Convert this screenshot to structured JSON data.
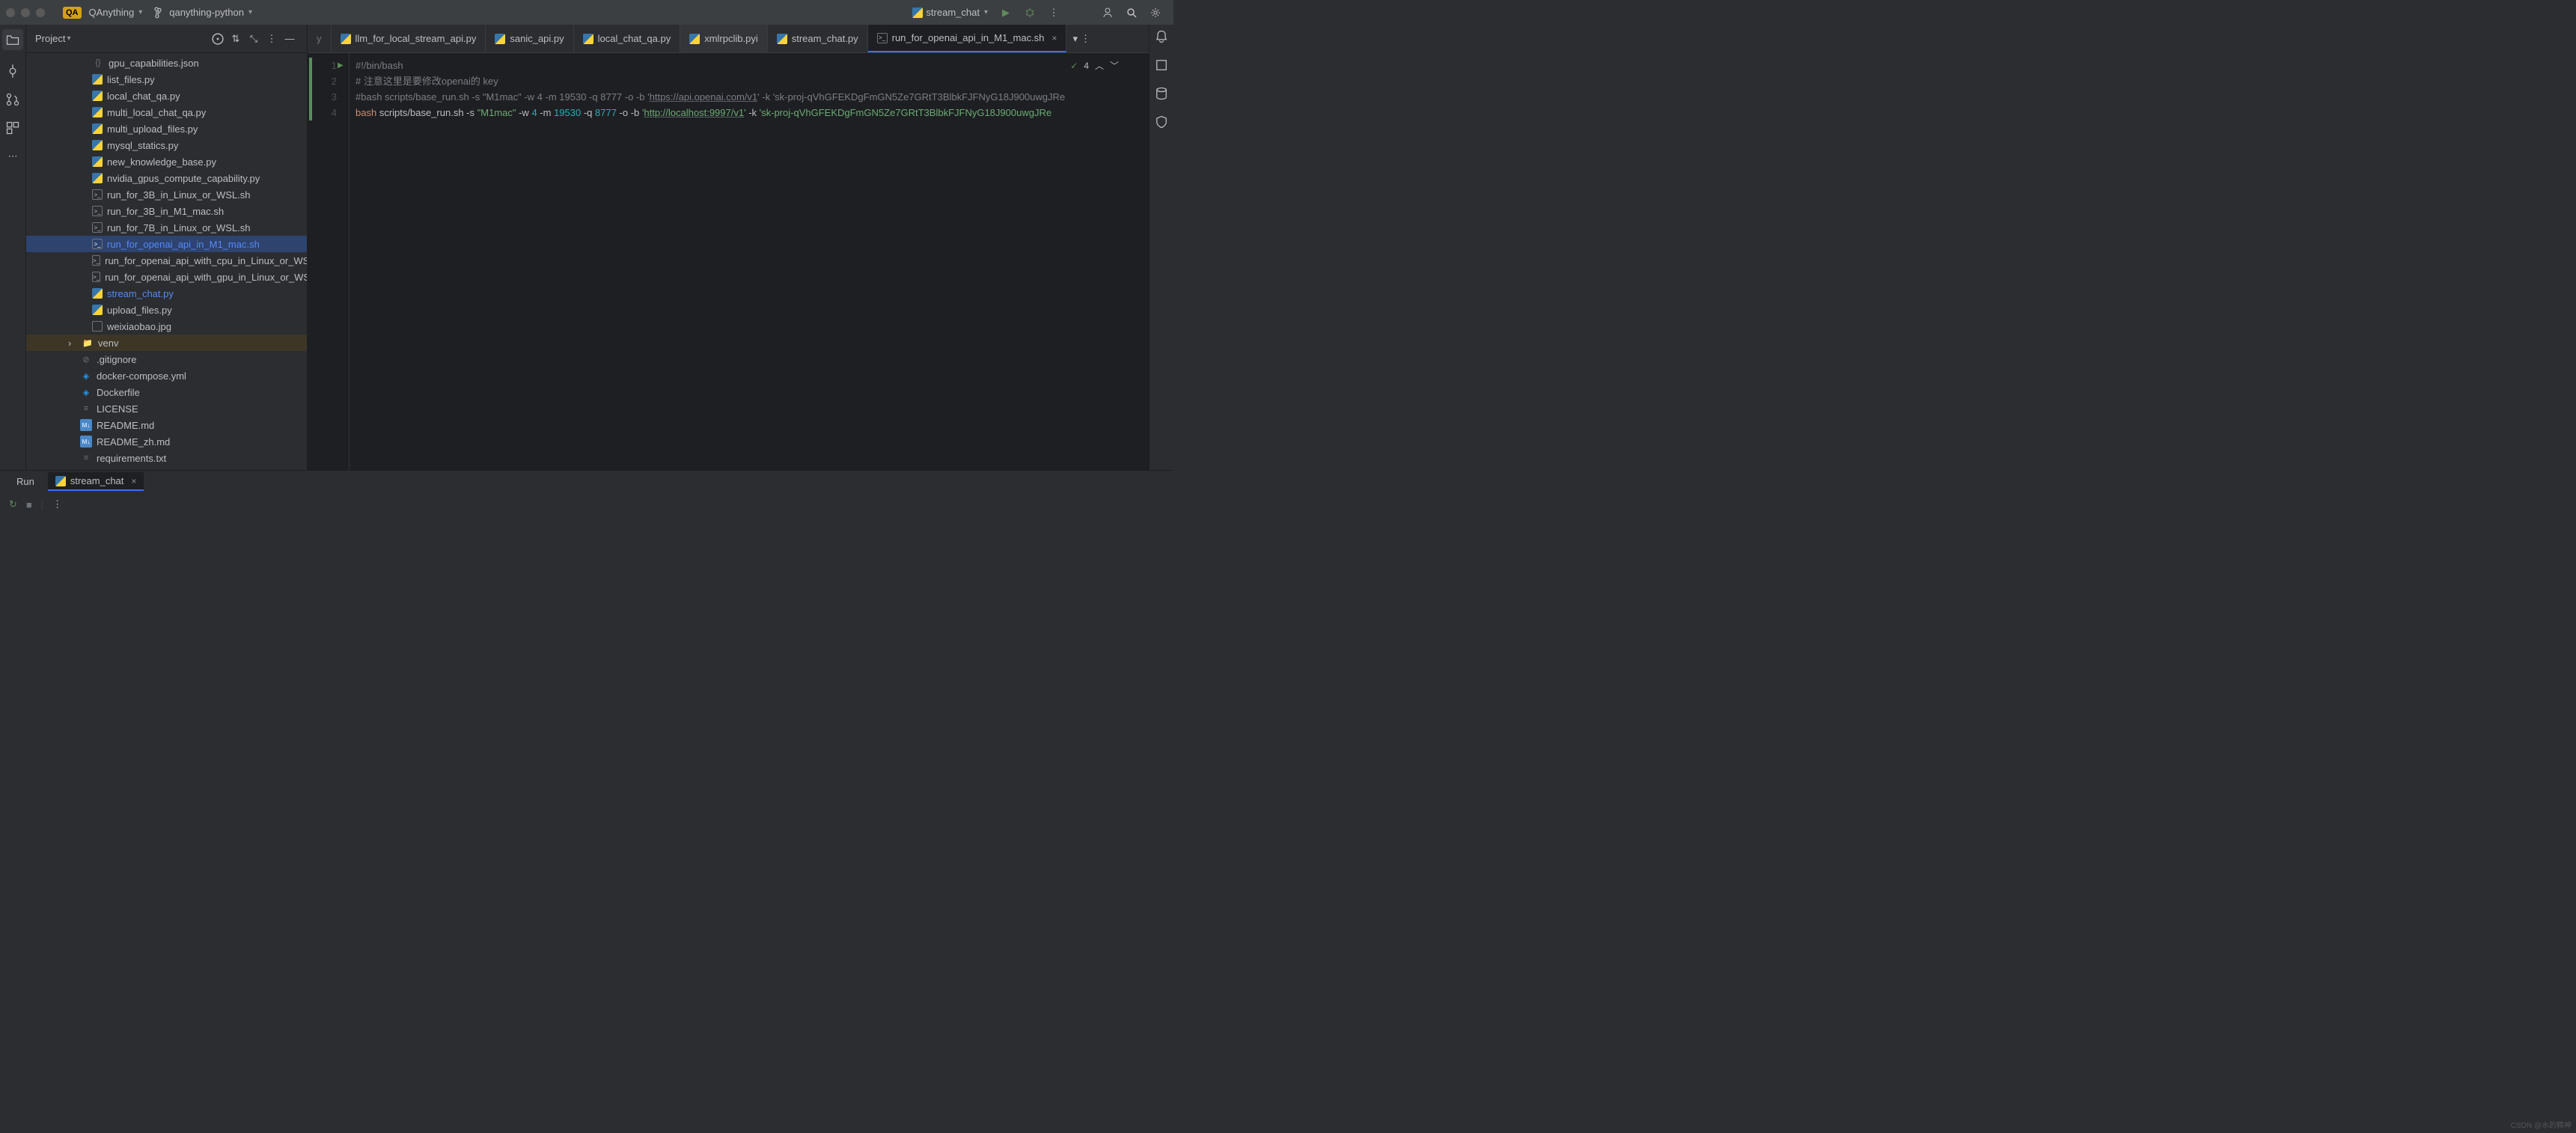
{
  "titlebar": {
    "project_badge": "QA",
    "project_name": "QAnything",
    "branch_name": "qanything-python",
    "run_config": "stream_chat"
  },
  "sidebar": {
    "header_title": "Project",
    "files": [
      {
        "name": "gpu_capabilities.json",
        "icon": "json"
      },
      {
        "name": "list_files.py",
        "icon": "py"
      },
      {
        "name": "local_chat_qa.py",
        "icon": "py"
      },
      {
        "name": "multi_local_chat_qa.py",
        "icon": "py"
      },
      {
        "name": "multi_upload_files.py",
        "icon": "py"
      },
      {
        "name": "mysql_statics.py",
        "icon": "py"
      },
      {
        "name": "new_knowledge_base.py",
        "icon": "py"
      },
      {
        "name": "nvidia_gpus_compute_capability.py",
        "icon": "py"
      },
      {
        "name": "run_for_3B_in_Linux_or_WSL.sh",
        "icon": "sh"
      },
      {
        "name": "run_for_3B_in_M1_mac.sh",
        "icon": "sh"
      },
      {
        "name": "run_for_7B_in_Linux_or_WSL.sh",
        "icon": "sh"
      },
      {
        "name": "run_for_openai_api_in_M1_mac.sh",
        "icon": "sh",
        "selected": true
      },
      {
        "name": "run_for_openai_api_with_cpu_in_Linux_or_WSL.sh",
        "icon": "sh"
      },
      {
        "name": "run_for_openai_api_with_gpu_in_Linux_or_WSL.sh",
        "icon": "sh"
      },
      {
        "name": "stream_chat.py",
        "icon": "py",
        "highlight": true
      },
      {
        "name": "upload_files.py",
        "icon": "py"
      },
      {
        "name": "weixiaobao.jpg",
        "icon": "img"
      }
    ],
    "folders": [
      {
        "name": "venv",
        "icon": "folder"
      }
    ],
    "root_files": [
      {
        "name": ".gitignore",
        "icon": "gitignore"
      },
      {
        "name": "docker-compose.yml",
        "icon": "docker"
      },
      {
        "name": "Dockerfile",
        "icon": "docker"
      },
      {
        "name": "LICENSE",
        "icon": "txt"
      },
      {
        "name": "README.md",
        "icon": "md"
      },
      {
        "name": "README_zh.md",
        "icon": "md"
      },
      {
        "name": "requirements.txt",
        "icon": "txt"
      }
    ]
  },
  "tabs": [
    {
      "label": "y",
      "icon": "",
      "partial": true
    },
    {
      "label": "llm_for_local_stream_api.py",
      "icon": "py"
    },
    {
      "label": "sanic_api.py",
      "icon": "py"
    },
    {
      "label": "local_chat_qa.py",
      "icon": "py"
    },
    {
      "label": "xmlrpclib.pyi",
      "icon": "py",
      "shaded": true
    },
    {
      "label": "stream_chat.py",
      "icon": "py"
    },
    {
      "label": "run_for_openai_api_in_M1_mac.sh",
      "icon": "sh",
      "active": true,
      "closeable": true
    }
  ],
  "editor_status": {
    "check_count": "4"
  },
  "code_lines": [
    {
      "n": "1",
      "raw": "#!/bin/bash",
      "type": "shebang"
    },
    {
      "n": "2",
      "raw": "# 注意这里是要修改openai的 key",
      "type": "comment"
    },
    {
      "n": "3",
      "prefix": "#bash ",
      "path": "scripts/base_run.sh",
      "flags": " -s ",
      "str1": "\"M1mac\"",
      "flags2": " -w ",
      "num1": "4",
      "flags3": " -m ",
      "num2": "19530",
      "flags4": " -q ",
      "num3": "8777",
      "flags5": " -o -b ",
      "q1": "'",
      "url": "https://api.openai.com/v1",
      "q2": "'",
      "flags6": " -k ",
      "key": "'sk-proj-qVhGFEKDgFmGN5Ze7GRtT3BlbkFJFNyG18J900uwgJRe",
      "type": "commented"
    },
    {
      "n": "4",
      "cmd": "bash",
      "space": " ",
      "path": "scripts/base_run.sh",
      "flags": " -s ",
      "str1": "\"M1mac\"",
      "flags2": " -w ",
      "num1": "4",
      "flags3": " -m ",
      "num2": "19530",
      "flags4": " -q ",
      "num3": "8777",
      "flags5": " -o -b ",
      "q1": "'",
      "url": "http://localhost:9997/v1",
      "q2": "'",
      "flags6": " -k ",
      "key": "'sk-proj-qVhGFEKDgFmGN5Ze7GRtT3BlbkFJFNyG18J900uwgJRe",
      "type": "active"
    }
  ],
  "bottom": {
    "run_tab": "Run",
    "config_tab": "stream_chat"
  },
  "watermark": "CSDN @水的精神"
}
